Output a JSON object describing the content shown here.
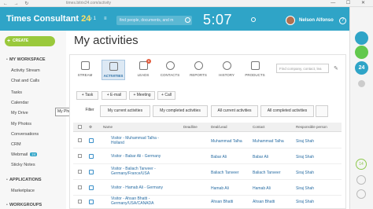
{
  "browser": {
    "nav_symbols": "← → ↻",
    "url": "times.bitrix24.com/activity",
    "window_controls": "— ☐ ✕"
  },
  "header": {
    "app_name": "Times Consultant",
    "app_badge": "24",
    "notifications_count": "1",
    "search_placeholder": "find people, documents, and m",
    "time": "5:07",
    "user_name": "Nelson Alfonso",
    "help_symbol": "?",
    "bell_symbol": "♪",
    "dots_symbol": "≡"
  },
  "sidebar": {
    "create_label": "CREATE",
    "workspace_title": "MY WORKSPACE",
    "items": [
      {
        "label": "Activity Stream"
      },
      {
        "label": "Chat and Calls"
      },
      {
        "label": "Tasks"
      },
      {
        "label": "Calendar"
      },
      {
        "label": "My Drive"
      },
      {
        "label": "My Photos"
      },
      {
        "label": "Conversations"
      },
      {
        "label": "CRM"
      },
      {
        "label": "Webmail",
        "badge": "24"
      },
      {
        "label": "Sticky Notes"
      }
    ],
    "applications_title": "APPLICATIONS",
    "app_items": [
      {
        "label": "Marketplace"
      }
    ],
    "groups_title": "WORKGROUPS",
    "tooltip": "My Photos"
  },
  "main": {
    "title": "My activities",
    "tabs": [
      {
        "label": "STREAM",
        "icon": "stream-icon"
      },
      {
        "label": "ACTIVITIES",
        "icon": "activities-icon",
        "active": true
      },
      {
        "label": "LEADS",
        "icon": "leads-icon",
        "badge": "6"
      },
      {
        "label": "CONTACTS",
        "icon": "contacts-icon"
      },
      {
        "label": "REPORTS",
        "icon": "reports-icon"
      },
      {
        "label": "HISTORY",
        "icon": "history-icon"
      },
      {
        "label": "PRODUCTS",
        "icon": "products-icon"
      }
    ],
    "search_placeholder": "Find company, contact, lea",
    "actions": [
      {
        "label": "+ Task"
      },
      {
        "label": "+ E-mail"
      },
      {
        "label": "+ Meeting"
      },
      {
        "label": "+ Call"
      }
    ],
    "filters": [
      {
        "label": "Filter"
      },
      {
        "label": "My current activities"
      },
      {
        "label": "My completed activities"
      },
      {
        "label": "All current activities"
      },
      {
        "label": "All completed activities"
      }
    ],
    "columns": [
      "Name",
      "Deadline",
      "Deal/Lead",
      "Contact",
      "Responsible person"
    ],
    "rows": [
      {
        "name": "Visitor - Muhammad Talha - Holland",
        "deal": "Muhammad Talha",
        "contact": "Muhammad Talha",
        "responsible": "Siraj Shah"
      },
      {
        "name": "Visitor - Babar Ali - Germany",
        "deal": "Babar Ali",
        "contact": "Babar Ali",
        "responsible": "Siraj Shah"
      },
      {
        "name": "Visitor - Baliach Tanveer - Germany/France/USA",
        "deal": "Baliach Tanveer",
        "contact": "Baliach Tanveer",
        "responsible": "Siraj Shah"
      },
      {
        "name": "Visitor - Hamab Ali - Germany",
        "deal": "Hamab Ali",
        "contact": "Hamab Ali",
        "responsible": "Siraj Shah"
      },
      {
        "name": "Visitor - Ahsan Bhatti - Germany/USA/CANADA",
        "deal": "Ahsan Bhatti",
        "contact": "Ahsan Bhatti",
        "responsible": "Siraj Shah"
      }
    ]
  },
  "rail": {
    "badge": "24",
    "bubble": "14"
  },
  "colors": {
    "header_bg": "#2fa4c7",
    "create_btn": "#9ac93c",
    "link": "#2a6ea4",
    "badge_red": "#e35b3c"
  }
}
